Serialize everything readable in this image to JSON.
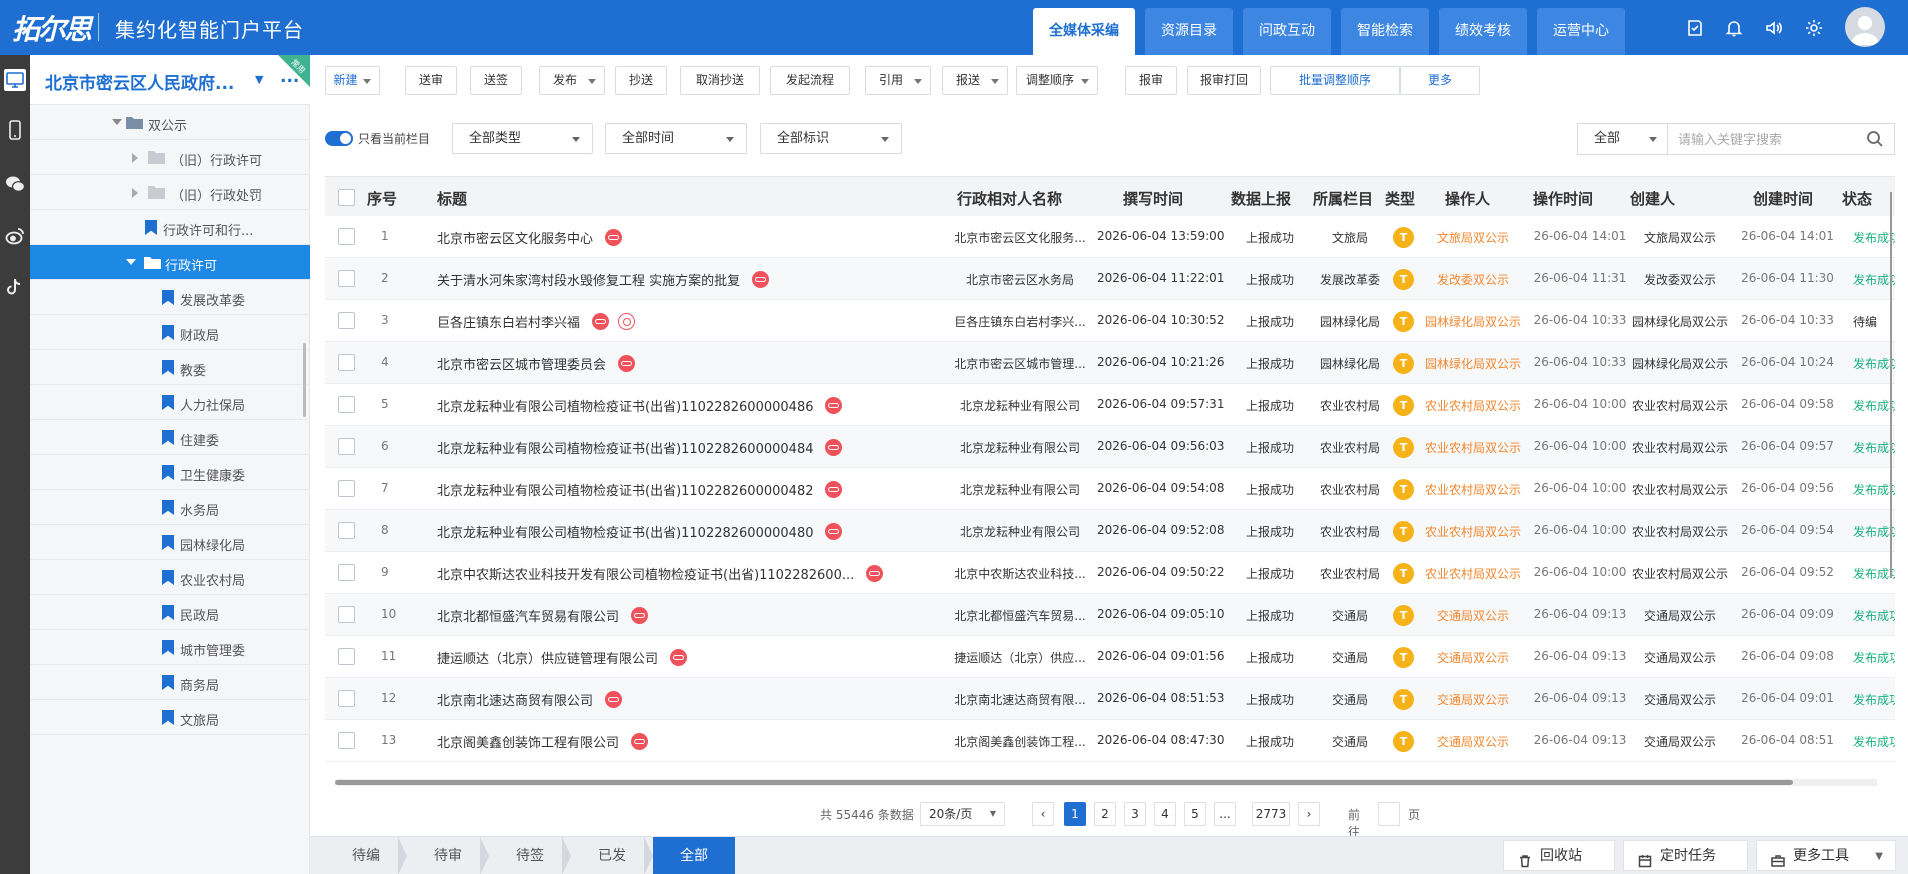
{
  "header": {
    "logo": "拓尔思",
    "platform": "集约化智能门户平台",
    "tabs": [
      {
        "label": "全媒体采编",
        "active": true
      },
      {
        "label": "资源目录",
        "active": false
      },
      {
        "label": "问政互动",
        "active": false
      },
      {
        "label": "智能检索",
        "active": false
      },
      {
        "label": "绩效考核",
        "active": false
      },
      {
        "label": "运营中心",
        "active": false
      }
    ],
    "icons": [
      "tasks-icon",
      "bell-icon",
      "speaker-icon",
      "gear-icon",
      "user-avatar"
    ]
  },
  "leftbar": {
    "icons": [
      "site-icon",
      "mobile-icon",
      "wechat-icon",
      "weibo-icon",
      "tiktok-icon"
    ]
  },
  "tree": {
    "site": "北京市密云区人民政府...",
    "more": "...",
    "new_tag": "常用",
    "nodes": [
      {
        "label": "双公示",
        "type": "folder-open",
        "indent": 1
      },
      {
        "label": "（旧）行政许可",
        "type": "folder",
        "indent": 2
      },
      {
        "label": "（旧）行政处罚",
        "type": "folder",
        "indent": 2
      },
      {
        "label": "行政许可和行...",
        "type": "bookmark",
        "indent": 1
      },
      {
        "label": "行政许可",
        "type": "folder-open",
        "indent": 1,
        "selected": true
      },
      {
        "label": "发展改革委",
        "type": "bookmark",
        "indent": 3
      },
      {
        "label": "财政局",
        "type": "bookmark",
        "indent": 3
      },
      {
        "label": "教委",
        "type": "bookmark",
        "indent": 3
      },
      {
        "label": "人力社保局",
        "type": "bookmark",
        "indent": 3
      },
      {
        "label": "住建委",
        "type": "bookmark",
        "indent": 3
      },
      {
        "label": "卫生健康委",
        "type": "bookmark",
        "indent": 3
      },
      {
        "label": "水务局",
        "type": "bookmark",
        "indent": 3
      },
      {
        "label": "园林绿化局",
        "type": "bookmark",
        "indent": 3
      },
      {
        "label": "农业农村局",
        "type": "bookmark",
        "indent": 3
      },
      {
        "label": "民政局",
        "type": "bookmark",
        "indent": 3
      },
      {
        "label": "城市管理委",
        "type": "bookmark",
        "indent": 3
      },
      {
        "label": "商务局",
        "type": "bookmark",
        "indent": 3
      },
      {
        "label": "文旅局",
        "type": "bookmark",
        "indent": 3
      }
    ]
  },
  "toolbar": {
    "buttons": [
      {
        "label": "新建",
        "dropdown": true,
        "blue": true
      },
      {
        "label": "送审"
      },
      {
        "label": "送签"
      },
      {
        "label": "发布",
        "dropdown": true
      },
      {
        "label": "抄送"
      },
      {
        "label": "取消抄送"
      },
      {
        "label": "发起流程"
      },
      {
        "label": "引用",
        "dropdown": true
      },
      {
        "label": "报送",
        "dropdown": true
      },
      {
        "label": "调整顺序",
        "dropdown": true
      },
      {
        "label": "报审"
      },
      {
        "label": "报审打回"
      },
      {
        "label": "批量调整顺序",
        "blue": true
      },
      {
        "label": "更多",
        "blue": true
      }
    ]
  },
  "filters": {
    "toggle_label": "只看当前栏目",
    "type": "全部类型",
    "time": "全部时间",
    "mark": "全部标识",
    "scope": "全部",
    "search_placeholder": "请输入关键字搜索"
  },
  "table": {
    "columns": [
      "序号",
      "标题",
      "行政相对人名称",
      "撰写时间",
      "数据上报",
      "所属栏目",
      "类型",
      "操作人",
      "操作时间",
      "创建人",
      "创建时间",
      "状态"
    ],
    "rows": [
      {
        "no": "1",
        "title": "北京市密云区文化服务中心",
        "icons": [
          "link"
        ],
        "party": "北京市密云区文化服务...",
        "written": "2026-06-04 13:59:00",
        "report": "上报成功",
        "column": "文旅局",
        "type": "T",
        "operator": "文旅局双公示",
        "optime": "26-06-04 14:01",
        "creator": "文旅局双公示",
        "ctime": "26-06-04 14:01",
        "status": "发布成功"
      },
      {
        "no": "2",
        "title": "关于清水河朱家湾村段水毁修复工程 实施方案的批复",
        "icons": [
          "link"
        ],
        "party": "北京市密云区水务局",
        "written": "2026-06-04 11:22:01",
        "report": "上报成功",
        "column": "发展改革委",
        "type": "T",
        "operator": "发改委双公示",
        "optime": "26-06-04 11:31",
        "creator": "发改委双公示",
        "ctime": "26-06-04 11:30",
        "status": "发布成功"
      },
      {
        "no": "3",
        "title": "巨各庄镇东白岩村李兴福",
        "icons": [
          "link",
          "weibo"
        ],
        "party": "巨各庄镇东白岩村李兴...",
        "written": "2026-06-04 10:30:52",
        "report": "上报成功",
        "column": "园林绿化局",
        "type": "T",
        "operator": "园林绿化局双公示",
        "optime": "26-06-04 10:33",
        "creator": "园林绿化局双公示",
        "ctime": "26-06-04 10:33",
        "status": "待编"
      },
      {
        "no": "4",
        "title": "北京市密云区城市管理委员会",
        "icons": [
          "link"
        ],
        "party": "北京市密云区城市管理...",
        "written": "2026-06-04 10:21:26",
        "report": "上报成功",
        "column": "园林绿化局",
        "type": "T",
        "operator": "园林绿化局双公示",
        "optime": "26-06-04 10:33",
        "creator": "园林绿化局双公示",
        "ctime": "26-06-04 10:24",
        "status": "发布成功"
      },
      {
        "no": "5",
        "title": "北京龙耘种业有限公司植物检疫证书(出省)1102282600000486",
        "icons": [
          "link"
        ],
        "party": "北京龙耘种业有限公司",
        "written": "2026-06-04 09:57:31",
        "report": "上报成功",
        "column": "农业农村局",
        "type": "T",
        "operator": "农业农村局双公示",
        "optime": "26-06-04 10:00",
        "creator": "农业农村局双公示",
        "ctime": "26-06-04 09:58",
        "status": "发布成功"
      },
      {
        "no": "6",
        "title": "北京龙耘种业有限公司植物检疫证书(出省)1102282600000484",
        "icons": [
          "link"
        ],
        "party": "北京龙耘种业有限公司",
        "written": "2026-06-04 09:56:03",
        "report": "上报成功",
        "column": "农业农村局",
        "type": "T",
        "operator": "农业农村局双公示",
        "optime": "26-06-04 10:00",
        "creator": "农业农村局双公示",
        "ctime": "26-06-04 09:57",
        "status": "发布成功"
      },
      {
        "no": "7",
        "title": "北京龙耘种业有限公司植物检疫证书(出省)1102282600000482",
        "icons": [
          "link"
        ],
        "party": "北京龙耘种业有限公司",
        "written": "2026-06-04 09:54:08",
        "report": "上报成功",
        "column": "农业农村局",
        "type": "T",
        "operator": "农业农村局双公示",
        "optime": "26-06-04 10:00",
        "creator": "农业农村局双公示",
        "ctime": "26-06-04 09:56",
        "status": "发布成功"
      },
      {
        "no": "8",
        "title": "北京龙耘种业有限公司植物检疫证书(出省)1102282600000480",
        "icons": [
          "link"
        ],
        "party": "北京龙耘种业有限公司",
        "written": "2026-06-04 09:52:08",
        "report": "上报成功",
        "column": "农业农村局",
        "type": "T",
        "operator": "农业农村局双公示",
        "optime": "26-06-04 10:00",
        "creator": "农业农村局双公示",
        "ctime": "26-06-04 09:54",
        "status": "发布成功"
      },
      {
        "no": "9",
        "title": "北京中农斯达农业科技开发有限公司植物检疫证书(出省)1102282600...",
        "icons": [
          "link"
        ],
        "party": "北京中农斯达农业科技...",
        "written": "2026-06-04 09:50:22",
        "report": "上报成功",
        "column": "农业农村局",
        "type": "T",
        "operator": "农业农村局双公示",
        "optime": "26-06-04 10:00",
        "creator": "农业农村局双公示",
        "ctime": "26-06-04 09:52",
        "status": "发布成功"
      },
      {
        "no": "10",
        "title": "北京北都恒盛汽车贸易有限公司",
        "icons": [
          "link"
        ],
        "party": "北京北都恒盛汽车贸易...",
        "written": "2026-06-04 09:05:10",
        "report": "上报成功",
        "column": "交通局",
        "type": "T",
        "operator": "交通局双公示",
        "optime": "26-06-04 09:13",
        "creator": "交通局双公示",
        "ctime": "26-06-04 09:09",
        "status": "发布成功"
      },
      {
        "no": "11",
        "title": "捷运顺达（北京）供应链管理有限公司",
        "icons": [
          "link"
        ],
        "party": "捷运顺达（北京）供应...",
        "written": "2026-06-04 09:01:56",
        "report": "上报成功",
        "column": "交通局",
        "type": "T",
        "operator": "交通局双公示",
        "optime": "26-06-04 09:13",
        "creator": "交通局双公示",
        "ctime": "26-06-04 09:08",
        "status": "发布成功"
      },
      {
        "no": "12",
        "title": "北京南北速达商贸有限公司",
        "icons": [
          "link"
        ],
        "party": "北京南北速达商贸有限...",
        "written": "2026-06-04 08:51:53",
        "report": "上报成功",
        "column": "交通局",
        "type": "T",
        "operator": "交通局双公示",
        "optime": "26-06-04 09:13",
        "creator": "交通局双公示",
        "ctime": "26-06-04 09:01",
        "status": "发布成功"
      },
      {
        "no": "13",
        "title": "北京阁美鑫创装饰工程有限公司",
        "icons": [
          "link"
        ],
        "party": "北京阁美鑫创装饰工程...",
        "written": "2026-06-04 08:47:30",
        "report": "上报成功",
        "column": "交通局",
        "type": "T",
        "operator": "交通局双公示",
        "optime": "26-06-04 09:13",
        "creator": "交通局双公示",
        "ctime": "26-06-04 08:51",
        "status": "发布成功"
      }
    ]
  },
  "pagination": {
    "total_text": "共 55446 条数据",
    "page_size": "20条/页",
    "pages": [
      "1",
      "2",
      "3",
      "4",
      "5",
      "...",
      "2773"
    ],
    "current": "1",
    "goto_label": "前往",
    "page_unit": "页"
  },
  "bottom": {
    "tabs": [
      {
        "label": "待编",
        "active": false
      },
      {
        "label": "待审",
        "active": false
      },
      {
        "label": "待签",
        "active": false
      },
      {
        "label": "已发",
        "active": false
      },
      {
        "label": "全部",
        "active": true
      }
    ],
    "recycle": "回收站",
    "scheduled": "定时任务",
    "more_tools": "更多工具"
  },
  "colors": {
    "primary": "#1e6fd1",
    "orange": "#f2862d",
    "success": "#19b07e",
    "badge": "#f5b319",
    "link_icon": "#f0525c"
  }
}
